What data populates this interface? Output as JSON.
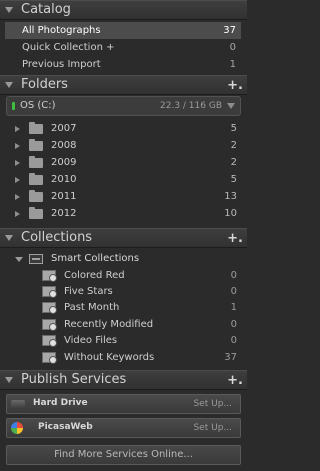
{
  "catalog": {
    "title": "Catalog",
    "items": [
      {
        "label": "All Photographs",
        "count": "37",
        "selected": true
      },
      {
        "label": "Quick Collection +",
        "count": "0"
      },
      {
        "label": "Previous Import",
        "count": "1"
      }
    ]
  },
  "folders": {
    "title": "Folders",
    "add_label": "+.",
    "volume": {
      "name": "OS (C:)",
      "size": "22.3 / 116 GB"
    },
    "items": [
      {
        "label": "2007",
        "count": "5"
      },
      {
        "label": "2008",
        "count": "2"
      },
      {
        "label": "2009",
        "count": "2"
      },
      {
        "label": "2010",
        "count": "5"
      },
      {
        "label": "2011",
        "count": "13"
      },
      {
        "label": "2012",
        "count": "10"
      }
    ]
  },
  "collections": {
    "title": "Collections",
    "add_label": "+.",
    "set": {
      "label": "Smart Collections"
    },
    "items": [
      {
        "label": "Colored Red",
        "count": "0"
      },
      {
        "label": "Five Stars",
        "count": "0"
      },
      {
        "label": "Past Month",
        "count": "1"
      },
      {
        "label": "Recently Modified",
        "count": "0"
      },
      {
        "label": "Video Files",
        "count": "0"
      },
      {
        "label": "Without Keywords",
        "count": "37"
      }
    ]
  },
  "publish": {
    "title": "Publish Services",
    "add_label": "+.",
    "services": [
      {
        "name": "Hard Drive",
        "action": "Set Up...",
        "icon": "hard-drive-icon"
      },
      {
        "name": "PicasaWeb",
        "action": "Set Up...",
        "icon": "picasaweb-icon"
      }
    ],
    "find_more": "Find More Services Online..."
  }
}
